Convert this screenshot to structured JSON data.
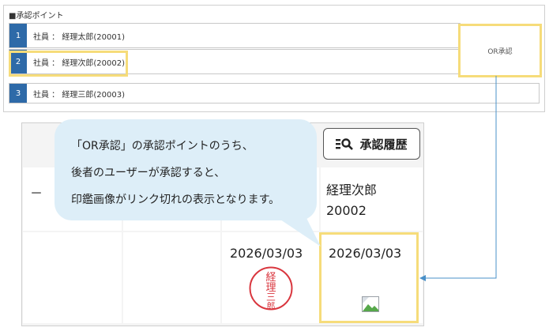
{
  "approval_points": {
    "section_title": "■承認ポイント",
    "rows": [
      {
        "num": "1",
        "label": "社員 ： 経理太郎(20001)"
      },
      {
        "num": "2",
        "label": "社員 ： 経理次郎(20002)"
      },
      {
        "num": "3",
        "label": "社員 ： 経理三郎(20003)"
      }
    ],
    "or_label": "OR承認"
  },
  "history_panel": {
    "history_button_label": "承認履歴",
    "dash": "－",
    "approver_name": "経理次郎",
    "approver_id": "20002",
    "date_left": "2026/03/03",
    "date_right": "2026/03/03",
    "seal_chars": [
      "経",
      "理",
      "三",
      "郎"
    ]
  },
  "callout": {
    "lines": [
      "「OR承認」の承認ポイントのうち、",
      "後者のユーザーが承認すると、",
      "印鑑画像がリンク切れの表示となります。"
    ]
  },
  "colors": {
    "highlight": "#f6dc7a",
    "row_number_bg": "#2e6aa8",
    "callout_bg": "#ddeef8",
    "connector": "#4a90c8",
    "seal": "#d9363e"
  }
}
